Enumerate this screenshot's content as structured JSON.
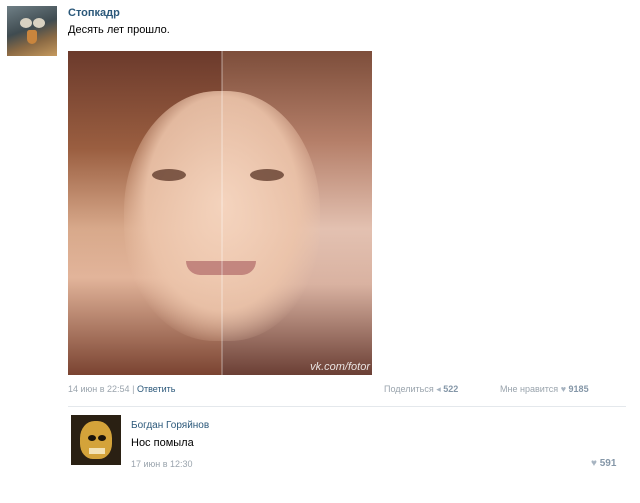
{
  "post": {
    "author": "Стопкадр",
    "text": "Десять лет прошло.",
    "watermark": "vk.com/fotor",
    "date": "14 июн в 22:54",
    "divider": "|",
    "reply_label": "Ответить",
    "share_label": "Поделиться",
    "share_count": "522",
    "like_label": "Мне нравится",
    "like_count": "9185"
  },
  "comment": {
    "author": "Богдан Горяйнов",
    "text": "Нос помыла",
    "date": "17 июн в 12:30",
    "like_count": "591"
  },
  "icons": {
    "share": "megaphone-icon",
    "like": "heart-icon"
  },
  "colors": {
    "link": "#2b587a",
    "meta": "#9aa4ad"
  }
}
